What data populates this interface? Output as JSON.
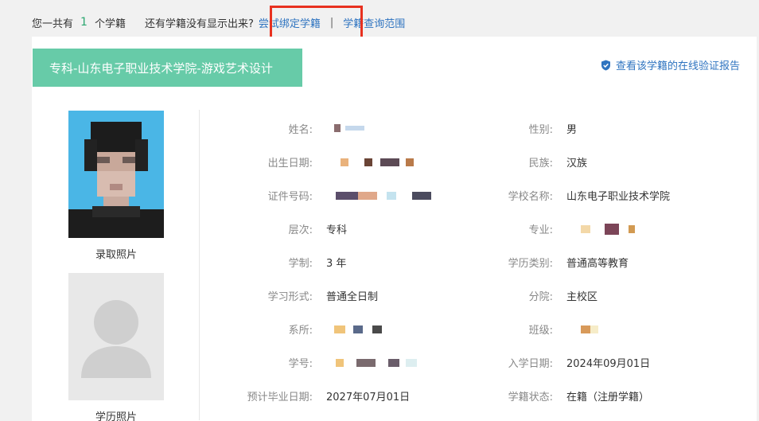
{
  "top": {
    "prefix": "您一共有",
    "count": "1",
    "suffix": "个学籍",
    "missing_text": "还有学籍没有显示出来?",
    "bind_link": "尝试绑定学籍",
    "separator": "|",
    "scope_link": "学籍查询范围"
  },
  "record": {
    "title": "专科-山东电子职业技术学院-游戏艺术设计",
    "verify_link": "查看该学籍的在线验证报告",
    "admission_photo_label": "录取照片",
    "degree_photo_label": "学历照片"
  },
  "fields": {
    "name_label": "姓名:",
    "gender_label": "性别:",
    "gender": "男",
    "birth_label": "出生日期:",
    "ethnicity_label": "民族:",
    "ethnicity": "汉族",
    "id_label": "证件号码:",
    "school_label": "学校名称:",
    "school": "山东电子职业技术学院",
    "level_label": "层次:",
    "level": "专科",
    "major_label": "专业:",
    "duration_label": "学制:",
    "duration": "3 年",
    "category_label": "学历类别:",
    "category": "普通高等教育",
    "mode_label": "学习形式:",
    "mode": "普通全日制",
    "branch_label": "分院:",
    "branch": "主校区",
    "department_label": "系所:",
    "class_label": "班级:",
    "student_no_label": "学号:",
    "enroll_date_label": "入学日期:",
    "enroll_date": "2024年09月01日",
    "grad_date_label": "预计毕业日期:",
    "grad_date": "2027年07月01日",
    "status_label": "学籍状态:",
    "status": "在籍（注册学籍）"
  },
  "colors": {
    "accent_green": "#67cba8",
    "count_green": "#2aa66f",
    "link_blue": "#2f74c0",
    "highlight_red": "#e8311f",
    "photo_bg": "#4ab6e6"
  }
}
